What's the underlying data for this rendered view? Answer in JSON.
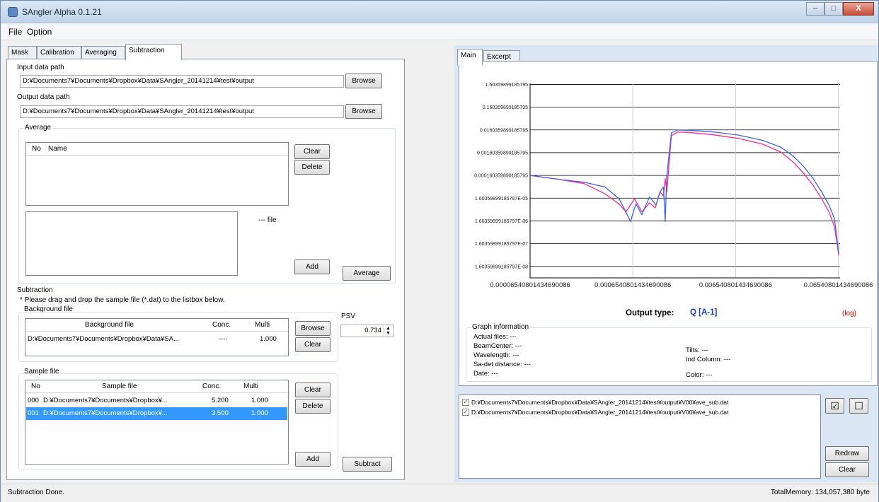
{
  "window": {
    "title": "SAngler Alpha 0.1.21",
    "buttons": {
      "minimize": "–",
      "maximize": "□",
      "close": "X"
    }
  },
  "menu": [
    "File",
    "Option"
  ],
  "tabs": [
    "Mask",
    "Calibration",
    "Averaging",
    "Subtraction"
  ],
  "active_tab": "Subtraction",
  "paths": {
    "input_label": "Input data path",
    "input_value": "D:¥Documents7¥Documents¥Dropbox¥Data¥SAngler_20141214¥test¥output",
    "output_label": "Output data path",
    "output_value": "D:¥Documents7¥Documents¥Dropbox¥Data¥SAngler_20141214¥test¥output",
    "browse": "Browse"
  },
  "average": {
    "group": "Average",
    "headers": [
      "No",
      "Name"
    ],
    "clear": "Clear",
    "delete": "Delete",
    "file_count": "--- file",
    "add": "Add",
    "average": "Average"
  },
  "subtraction": {
    "group": "Subtraction",
    "hint": "* Please drag and drop the sample file (*.dat) to the listbox below.",
    "background_label": "Background file",
    "bg_headers": [
      "Background file",
      "Conc.",
      "Multi"
    ],
    "bg_row": {
      "file": "D:¥Documents7¥Documents¥Dropbox¥Data¥SA...",
      "conc": "----",
      "multi": "1.000"
    },
    "browse": "Browse",
    "clear": "Clear",
    "psv_label": "PSV",
    "psv_value": "0.734",
    "sample_label": "Sample file",
    "sample_headers": [
      "No",
      "Sample file",
      "Conc.",
      "Multi"
    ],
    "sample_rows": [
      {
        "no": "000",
        "file": "D:¥Documents7¥Documents¥Dropbox¥...",
        "conc": "5.200",
        "multi": "1.000"
      },
      {
        "no": "001",
        "file": "D:¥Documents7¥Documents¥Dropbox¥...",
        "conc": "3.500",
        "multi": "1.000"
      }
    ],
    "sample_clear": "Clear",
    "sample_delete": "Delete",
    "sample_add": "Add",
    "subtract": "Subtract"
  },
  "right_tabs": [
    "Main",
    "Excerpt"
  ],
  "chart_data": {
    "type": "line",
    "x_scale": "log",
    "y_scale": "log",
    "y_tick_labels": [
      "1.60359899185795",
      "0.160359899185795",
      "0.0160359899185795",
      "0.00160359899185795",
      "0.000160359899185795",
      "1.60359899185797E-05",
      "1.60359899185797E-06",
      "1.60359899185797E-07",
      "1.60359899185797E-08"
    ],
    "x_tick_labels": [
      "0.00006540801434690086",
      "0.0006540801434690086",
      "0.006540801434690086",
      "0.06540801434690086"
    ],
    "x_tick_values": [
      6.54e-05,
      0.000654,
      0.00654,
      0.0654
    ],
    "series": [
      {
        "color": "#ff2a8f",
        "x": [
          6.55e-05,
          0.00012,
          0.00022,
          0.00035,
          0.00048,
          0.00056,
          0.00068,
          0.0008,
          0.00095,
          0.00108,
          0.0012,
          0.0013,
          0.00135,
          0.0014,
          0.00155,
          0.0018,
          0.0025,
          0.004,
          0.007,
          0.012,
          0.018,
          0.024,
          0.03,
          0.037,
          0.045,
          0.053,
          0.06,
          0.066
        ],
        "y": [
          0.00016,
          0.00011,
          7e-05,
          2.5e-05,
          9e-06,
          4e-06,
          1.5e-05,
          4e-06,
          1e-05,
          6e-06,
          3e-05,
          2e-05,
          0.00012,
          3e-05,
          0.009,
          0.013,
          0.012,
          0.0098,
          0.0068,
          0.0038,
          0.0017,
          0.0006,
          0.0002,
          6e-05,
          1.5e-05,
          4e-06,
          9e-07,
          5e-08
        ]
      },
      {
        "color": "#4262e8",
        "x": [
          6.55e-05,
          0.00012,
          0.00022,
          0.00035,
          0.00048,
          0.00056,
          0.00062,
          0.0007,
          0.0008,
          0.00095,
          0.0011,
          0.0012,
          0.0013,
          0.00135,
          0.0014,
          0.00155,
          0.0018,
          0.0025,
          0.004,
          0.007,
          0.012,
          0.018,
          0.024,
          0.03,
          0.037,
          0.045,
          0.053,
          0.06,
          0.066
        ],
        "y": [
          0.00016,
          0.00011,
          8e-05,
          5e-05,
          1.5e-05,
          4e-06,
          1.5e-06,
          9e-06,
          3e-06,
          1.8e-05,
          8e-06,
          3e-05,
          5e-05,
          1.5e-06,
          0.00015,
          0.012,
          0.016,
          0.015,
          0.013,
          0.0095,
          0.0056,
          0.0028,
          0.0011,
          0.0004,
          0.00012,
          3e-05,
          8e-06,
          2e-06,
          6e-08
        ]
      }
    ]
  },
  "output": {
    "label": "Output type:",
    "value": "Q [A-1]",
    "scale": "(log)"
  },
  "graph_info": {
    "group": "Graph information",
    "left": [
      {
        "label": "Actual files:",
        "value": "---"
      },
      {
        "label": "BeamCenter:",
        "value": "---"
      },
      {
        "label": "Wavelength:",
        "value": "---"
      },
      {
        "label": "Sa-det distance:",
        "value": "---"
      },
      {
        "label": "Date:",
        "value": "---"
      }
    ],
    "right": [
      {
        "label": "Tilts:",
        "value": "---"
      },
      {
        "label": "Ind Column:",
        "value": "---"
      },
      {
        "label": "Color:",
        "value": "---"
      }
    ]
  },
  "file_list": [
    {
      "checked": true,
      "path": "D:¥Documents7¥Documents¥Dropbox¥Data¥SAngler_20141214¥test¥output¥V00¥ave_sub.dat"
    },
    {
      "checked": true,
      "path": "D:¥Documents7¥Documents¥Dropbox¥Data¥SAngler_20141214¥test¥output¥V00¥ave_sub.dat"
    }
  ],
  "right_buttons": {
    "redraw": "Redraw",
    "clear": "Clear",
    "check_all": "☑",
    "uncheck_all": "☐"
  },
  "status": {
    "left": "Subtraction Done.",
    "right": "TotalMemory: 134,057,380 byte"
  }
}
